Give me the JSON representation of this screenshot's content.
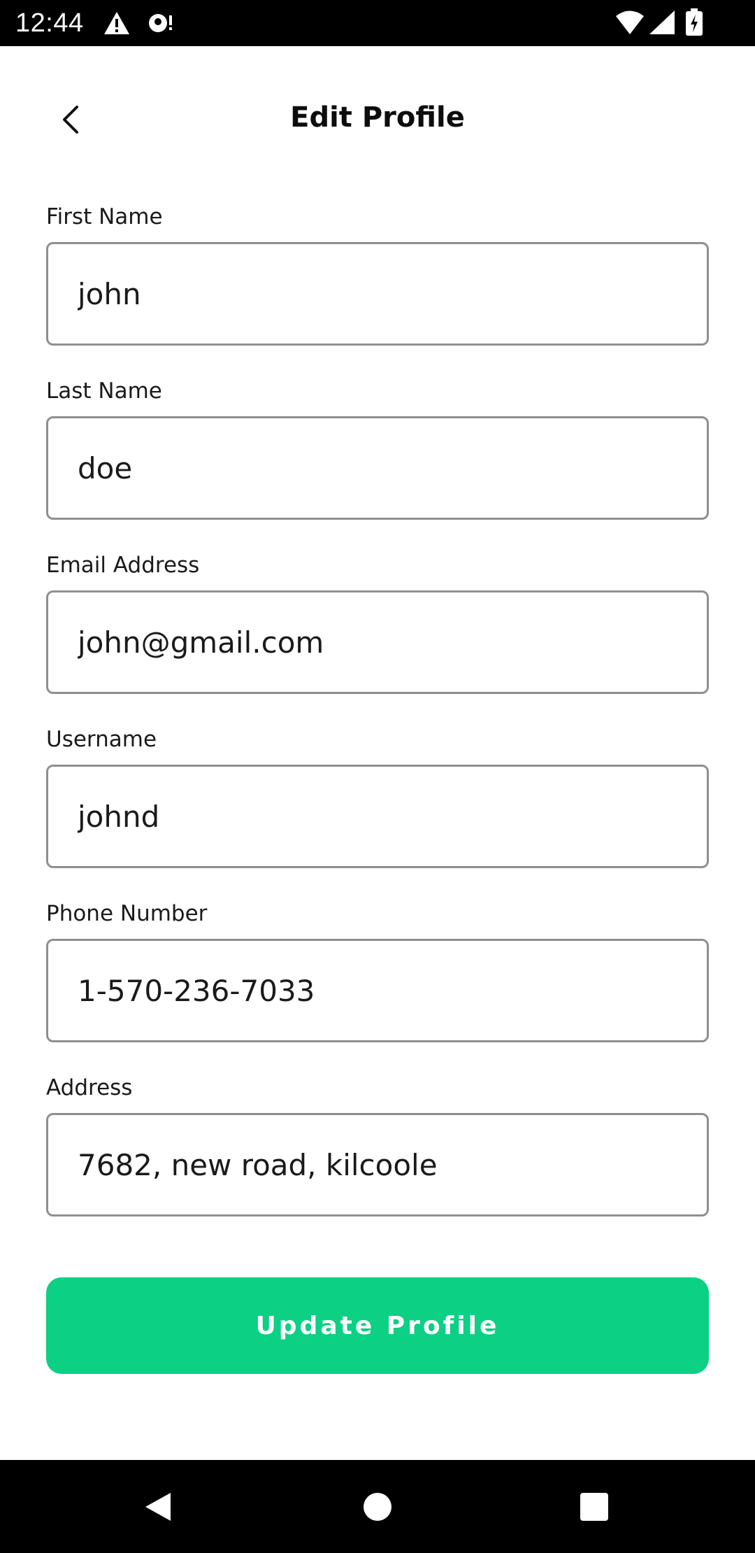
{
  "status_bar": {
    "time": "12:44",
    "icons": [
      "warning-icon",
      "notification-icon",
      "wifi-icon",
      "signal-icon",
      "battery-charging-icon"
    ]
  },
  "header": {
    "title": "Edit Profile",
    "back_icon": "chevron-left-icon"
  },
  "form": {
    "fields": [
      {
        "label": "First Name",
        "value": "john"
      },
      {
        "label": "Last Name",
        "value": "doe"
      },
      {
        "label": "Email Address",
        "value": "john@gmail.com"
      },
      {
        "label": "Username",
        "value": "johnd"
      },
      {
        "label": "Phone Number",
        "value": "1-570-236-7033"
      },
      {
        "label": "Address",
        "value": "7682, new road, kilcoole"
      }
    ],
    "submit_label": "Update Profile"
  },
  "nav_bar": {
    "icons": [
      "nav-back-icon",
      "nav-home-icon",
      "nav-recents-icon"
    ]
  },
  "colors": {
    "accent": "#0cd084",
    "input_border": "#8f8f8f",
    "system_bars": "#000000"
  }
}
